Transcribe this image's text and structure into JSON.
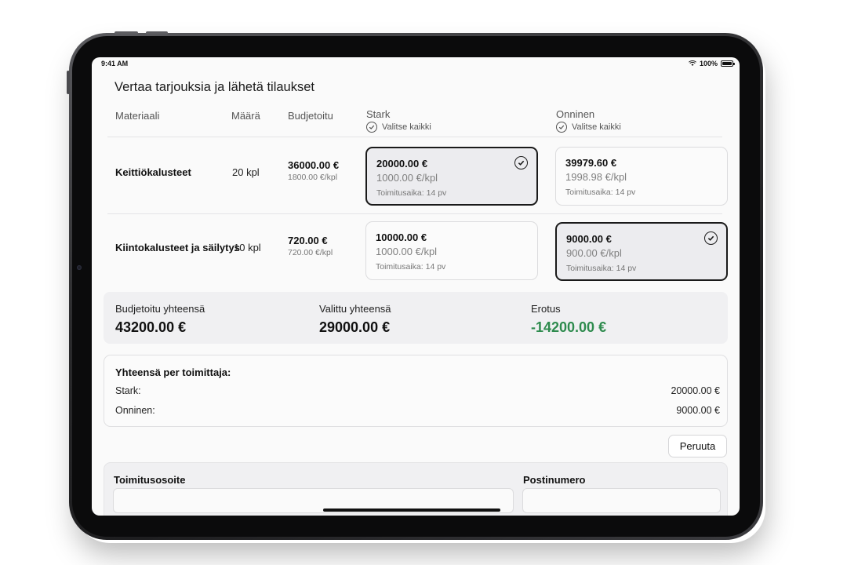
{
  "status_bar": {
    "time": "9:41 AM",
    "battery": "100%"
  },
  "page_title": "Vertaa tarjouksia ja lähetä tilaukset",
  "columns": {
    "material": "Materiaali",
    "quantity": "Määrä",
    "budgeted": "Budjetoitu",
    "suppliers": [
      {
        "name": "Stark",
        "select_all": "Valitse kaikki"
      },
      {
        "name": "Onninen",
        "select_all": "Valitse kaikki"
      }
    ]
  },
  "rows": [
    {
      "material": "Keittiökalusteet",
      "quantity": "20 kpl",
      "budget_total": "36000.00 €",
      "budget_unit": "1800.00 €/kpl",
      "offers": [
        {
          "price": "20000.00 €",
          "unit": "1000.00 €/kpl",
          "delivery": "Toimitusaika: 14 pv",
          "selected": true
        },
        {
          "price": "39979.60 €",
          "unit": "1998.98 €/kpl",
          "delivery": "Toimitusaika: 14 pv",
          "selected": false
        }
      ]
    },
    {
      "material": "Kiintokalusteet ja säilytys",
      "quantity": "10 kpl",
      "budget_total": "720.00 €",
      "budget_unit": "720.00 €/kpl",
      "offers": [
        {
          "price": "10000.00 €",
          "unit": "1000.00 €/kpl",
          "delivery": "Toimitusaika: 14 pv",
          "selected": false
        },
        {
          "price": "9000.00 €",
          "unit": "900.00 €/kpl",
          "delivery": "Toimitusaika: 14 pv",
          "selected": true
        }
      ]
    }
  ],
  "summary": {
    "budget_label": "Budjetoitu yhteensä",
    "budget_value": "43200.00 €",
    "selected_label": "Valittu yhteensä",
    "selected_value": "29000.00 €",
    "diff_label": "Erotus",
    "diff_value": "-14200.00 €"
  },
  "per_supplier": {
    "title": "Yhteensä per toimittaja:",
    "rows": [
      {
        "name": "Stark:",
        "value": "20000.00 €"
      },
      {
        "name": "Onninen:",
        "value": "9000.00 €"
      }
    ]
  },
  "cancel_label": "Peruuta",
  "address_form": {
    "address_label": "Toimitusosoite",
    "postal_label": "Postinumero"
  },
  "colors": {
    "positive_diff": "#2e8b4e",
    "selected_card_border": "#1a1a1a"
  },
  "icons": {
    "check": "check-circle-icon",
    "wifi": "wifi-icon",
    "battery": "battery-icon"
  }
}
